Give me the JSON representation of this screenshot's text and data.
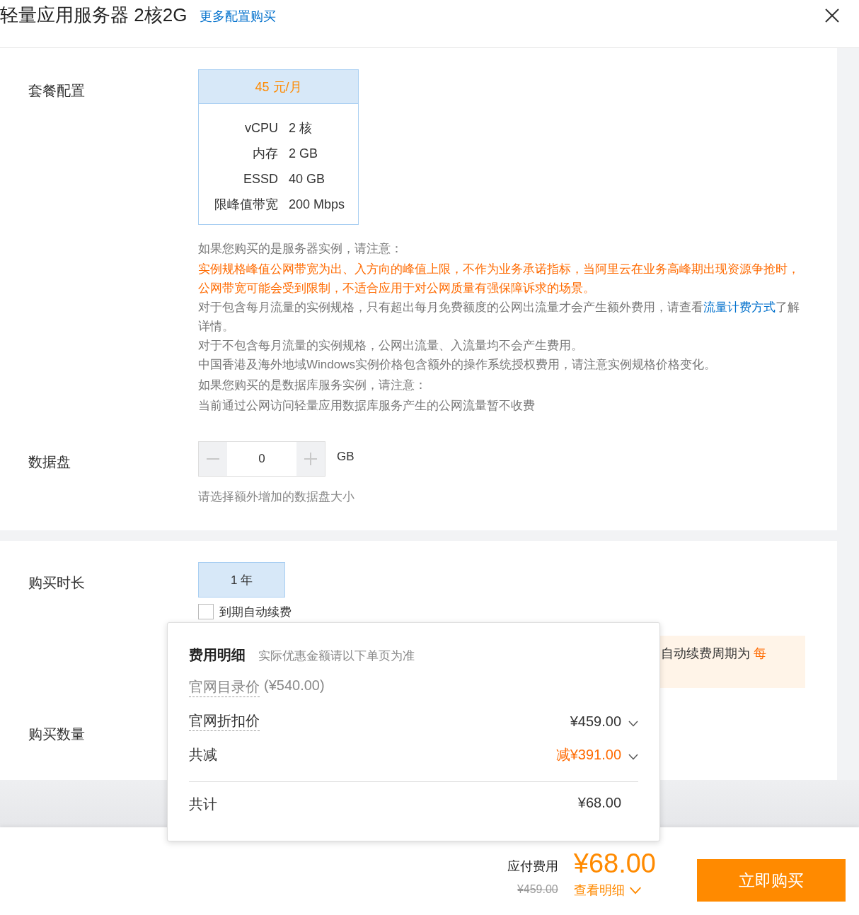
{
  "header": {
    "title": "轻量应用服务器 2核2G",
    "link": "更多配置购买"
  },
  "package": {
    "label": "套餐配置",
    "plans": [
      {
        "price": "45 元/月",
        "selected": true,
        "specs": [
          {
            "name": "vCPU",
            "value": "2 核"
          },
          {
            "name": "内存",
            "value": "2 GB"
          },
          {
            "name": "ESSD",
            "value": "40 GB"
          },
          {
            "name": "限峰值带宽",
            "value": "200 Mbps"
          }
        ]
      }
    ],
    "notes": [
      {
        "kind": "heading",
        "text": "如果您购买的是服务器实例，请注意："
      },
      {
        "kind": "warning",
        "text": "实例规格峰值公网带宽为出、入方向的峰值上限，不作为业务承诺指标，当阿里云在业务高峰期出现资源争抢时，公网带宽可能会受到限制，不适合应用于对公网质量有强保障诉求的场景。"
      },
      {
        "kind": "plain",
        "text": "对于包含每月流量的实例规格，只有超出每月免费额度的公网出流量才会产生额外费用，请查看",
        "link": "流量计费方式",
        "after": "了解详情。"
      },
      {
        "kind": "plain",
        "text": "对于不包含每月流量的实例规格，公网出流量、入流量均不会产生费用。"
      },
      {
        "kind": "plain",
        "text": "中国香港及海外地域Windows实例价格包含额外的操作系统授权费用，请注意实例规格价格变化。"
      },
      {
        "kind": "heading",
        "text": "如果您购买的是数据库服务实例，请注意："
      },
      {
        "kind": "heading",
        "text": "当前通过公网访问轻量应用数据库服务产生的公网流量暂不收费"
      }
    ]
  },
  "disk": {
    "label": "数据盘",
    "value": "0",
    "unit": "GB",
    "hint": "请选择额外增加的数据盘大小"
  },
  "duration": {
    "label": "购买时长",
    "options": [
      {
        "label": "1 年",
        "selected": true
      }
    ],
    "auto_renew": {
      "label": "到期自动续费",
      "checked": false
    },
    "notice": {
      "text": "自动续费周期为 ",
      "highlight": "每"
    }
  },
  "quantity": {
    "label": "购买数量"
  },
  "cost_popup": {
    "title": "费用明细",
    "subtitle": "实际优惠金额请以下单页为准",
    "list_label": "官网目录价",
    "list_value": "(¥540.00)",
    "rows": [
      {
        "kind": "price",
        "label": "官网折扣价",
        "value": "¥459.00"
      },
      {
        "kind": "saving",
        "label": "共减",
        "value": "减¥391.00"
      }
    ],
    "total": {
      "label": "共计",
      "value": "¥68.00"
    }
  },
  "footer": {
    "label": "应付费用",
    "price": "¥68.00",
    "original": "¥459.00",
    "details": "查看明细",
    "buy": "立即购买"
  }
}
